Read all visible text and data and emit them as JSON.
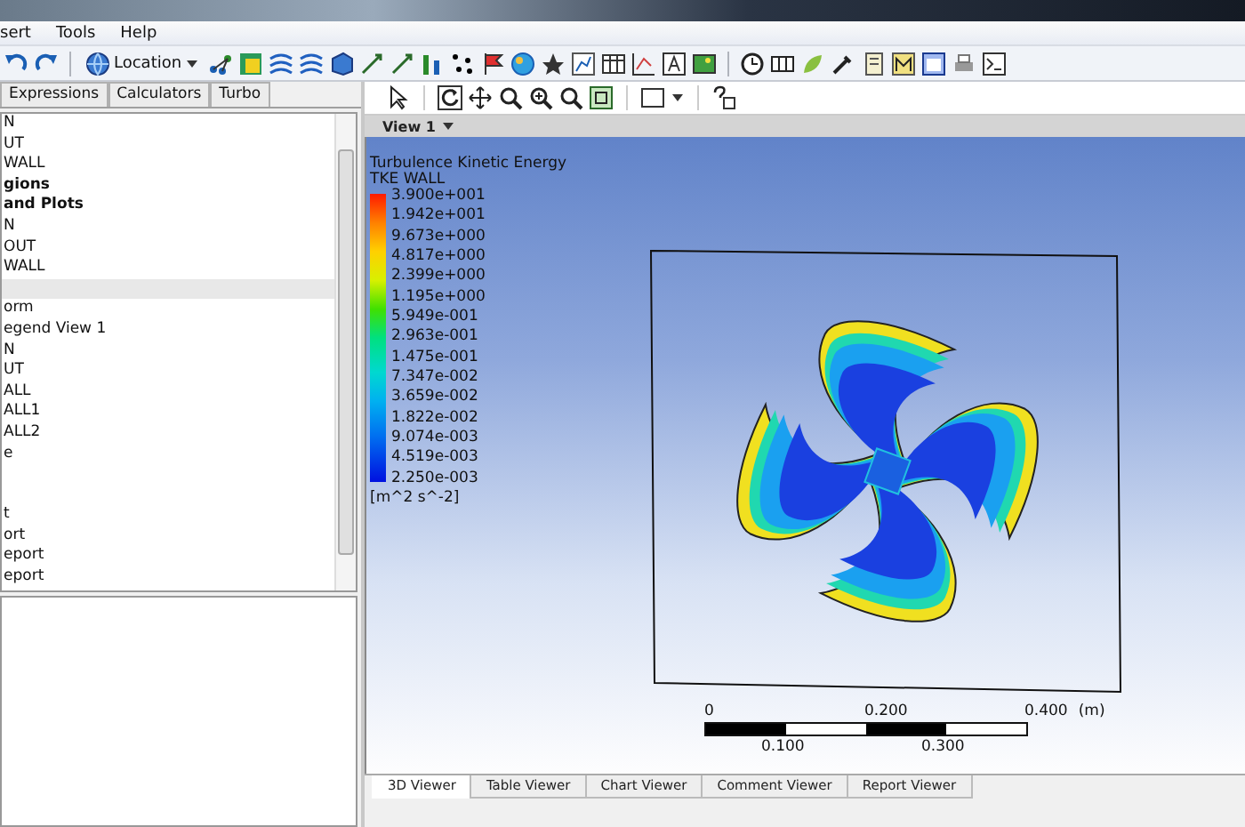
{
  "menu": [
    {
      "label": "sert"
    },
    {
      "label": "Tools"
    },
    {
      "label": "Help"
    }
  ],
  "toolbar": {
    "location_label": "Location"
  },
  "left_tabs": [
    {
      "label": "Expressions",
      "selected": false
    },
    {
      "label": "Calculators",
      "selected": false
    },
    {
      "label": "Turbo",
      "selected": false
    }
  ],
  "tree": [
    {
      "label": "N",
      "kind": "item",
      "selected": false
    },
    {
      "label": "UT",
      "kind": "item",
      "selected": false
    },
    {
      "label": "WALL",
      "kind": "item",
      "selected": false
    },
    {
      "label": "gions",
      "kind": "group",
      "selected": false
    },
    {
      "label": "and Plots",
      "kind": "group",
      "selected": false
    },
    {
      "label": "N",
      "kind": "item",
      "selected": false
    },
    {
      "label": "OUT",
      "kind": "item",
      "selected": false
    },
    {
      "label": "WALL",
      "kind": "item",
      "selected": false
    },
    {
      "kind": "blank",
      "selected": true
    },
    {
      "label": "orm",
      "kind": "item",
      "selected": false
    },
    {
      "label": "egend View 1",
      "kind": "item",
      "selected": false
    },
    {
      "label": "N",
      "kind": "item",
      "selected": false
    },
    {
      "label": "UT",
      "kind": "item",
      "selected": false
    },
    {
      "label": "ALL",
      "kind": "item",
      "selected": false
    },
    {
      "label": "ALL1",
      "kind": "item",
      "selected": false
    },
    {
      "label": "ALL2",
      "kind": "item",
      "selected": false
    },
    {
      "label": "e",
      "kind": "item",
      "selected": false
    },
    {
      "kind": "blank"
    },
    {
      "kind": "blank"
    },
    {
      "label": "t",
      "kind": "item",
      "selected": false
    },
    {
      "label": "ort",
      "kind": "item",
      "selected": false
    },
    {
      "label": "eport",
      "kind": "item",
      "selected": false
    },
    {
      "label": "eport",
      "kind": "item",
      "selected": false
    }
  ],
  "view": {
    "title": "View 1"
  },
  "legend": {
    "title": "Turbulence Kinetic Energy",
    "subtitle": "TKE WALL",
    "labels": [
      "3.900e+001",
      "1.942e+001",
      "9.673e+000",
      "4.817e+000",
      "2.399e+000",
      "1.195e+000",
      "5.949e-001",
      "2.963e-001",
      "1.475e-001",
      "7.347e-002",
      "3.659e-002",
      "1.822e-002",
      "9.074e-003",
      "4.519e-003",
      "2.250e-003"
    ],
    "units": "[m^2 s^-2]"
  },
  "scale": {
    "top_labels": [
      "0",
      "0.200",
      "0.400"
    ],
    "unit": "(m)",
    "bottom_labels": [
      "0.100",
      "0.300"
    ]
  },
  "viewer_tabs": [
    {
      "label": "3D Viewer",
      "selected": true
    },
    {
      "label": "Table Viewer",
      "selected": false
    },
    {
      "label": "Chart Viewer",
      "selected": false
    },
    {
      "label": "Comment Viewer",
      "selected": false
    },
    {
      "label": "Report Viewer",
      "selected": false
    }
  ]
}
